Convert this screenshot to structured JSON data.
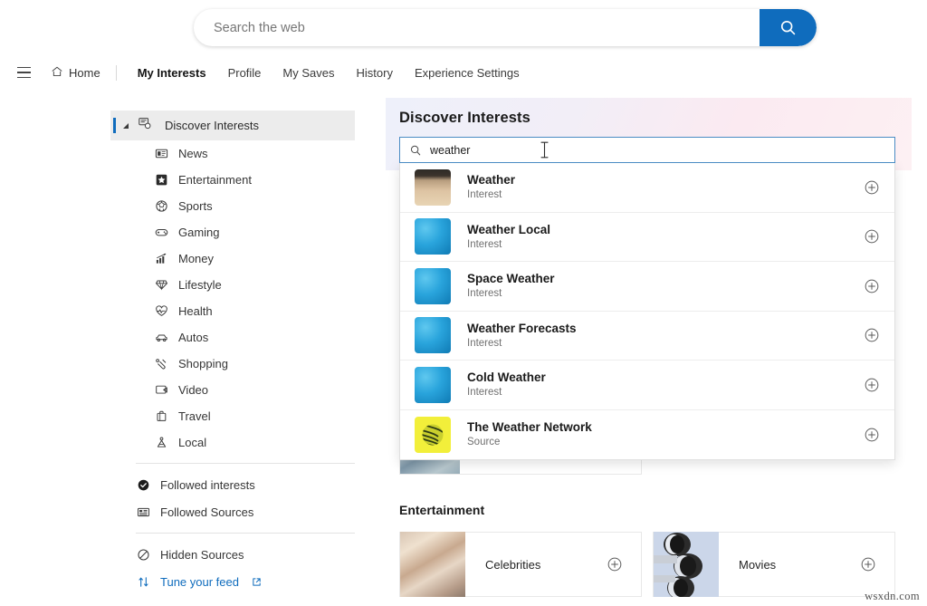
{
  "topbar": {
    "search_placeholder": "Search the web",
    "search_value": "",
    "search_button_icon": "search-icon"
  },
  "nav": {
    "menu_icon": "hamburger-menu-icon",
    "home_label": "Home",
    "home_icon": "home-icon",
    "links": [
      {
        "label": "My Interests",
        "active": true
      },
      {
        "label": "Profile",
        "active": false
      },
      {
        "label": "My Saves",
        "active": false
      },
      {
        "label": "History",
        "active": false
      },
      {
        "label": "Experience Settings",
        "active": false
      }
    ]
  },
  "sidebar": {
    "header": {
      "label": "Discover Interests",
      "icon": "discover-interests-icon",
      "expanded": true
    },
    "categories": [
      {
        "label": "News",
        "icon": "newspaper-icon"
      },
      {
        "label": "Entertainment",
        "icon": "star-badge-icon"
      },
      {
        "label": "Sports",
        "icon": "sports-ball-icon"
      },
      {
        "label": "Gaming",
        "icon": "gamepad-icon"
      },
      {
        "label": "Money",
        "icon": "bar-chart-icon"
      },
      {
        "label": "Lifestyle",
        "icon": "diamond-icon"
      },
      {
        "label": "Health",
        "icon": "heart-pulse-icon"
      },
      {
        "label": "Autos",
        "icon": "car-icon"
      },
      {
        "label": "Shopping",
        "icon": "shopping-tag-icon"
      },
      {
        "label": "Video",
        "icon": "video-screen-icon"
      },
      {
        "label": "Travel",
        "icon": "suitcase-icon"
      },
      {
        "label": "Local",
        "icon": "location-pin-person-icon"
      }
    ],
    "followed": [
      {
        "label": "Followed interests",
        "icon": "check-circle-filled-icon"
      },
      {
        "label": "Followed Sources",
        "icon": "sources-grid-icon"
      }
    ],
    "extras": [
      {
        "label": "Hidden Sources",
        "icon": "block-circle-icon",
        "link": false
      },
      {
        "label": "Tune your feed",
        "icon": "sort-arrows-icon",
        "link": true,
        "external_icon": "external-link-icon"
      }
    ]
  },
  "panel": {
    "title": "Discover Interests",
    "search": {
      "icon": "search-icon",
      "value": "weather",
      "placeholder": "",
      "cursor_icon": "text-ibeam-cursor"
    },
    "results": [
      {
        "title": "Weather",
        "subtitle": "Interest",
        "thumb": "tornado-photo",
        "add_icon": "plus-circle-icon"
      },
      {
        "title": "Weather Local",
        "subtitle": "Interest",
        "thumb": "blue-gradient-tile",
        "add_icon": "plus-circle-icon"
      },
      {
        "title": "Space Weather",
        "subtitle": "Interest",
        "thumb": "blue-gradient-tile",
        "add_icon": "plus-circle-icon"
      },
      {
        "title": "Weather Forecasts",
        "subtitle": "Interest",
        "thumb": "blue-gradient-tile",
        "add_icon": "plus-circle-icon"
      },
      {
        "title": "Cold Weather",
        "subtitle": "Interest",
        "thumb": "blue-gradient-tile",
        "add_icon": "plus-circle-icon"
      },
      {
        "title": "The Weather Network",
        "subtitle": "Source",
        "thumb": "yellow-globe-logo",
        "add_icon": "plus-circle-icon"
      }
    ]
  },
  "content": {
    "section_title": "Entertainment",
    "cards": [
      {
        "label": "Celebrities",
        "thumb": "celebrities-crowd-photo",
        "add_icon": "plus-circle-icon"
      },
      {
        "label": "Movies",
        "thumb": "movie-camera-lens-photo",
        "add_icon": "plus-circle-icon"
      }
    ]
  },
  "watermark": "wsxdn.com",
  "colors": {
    "accent_blue": "#0f6cbd",
    "search_button": "#0f6cbd",
    "link_blue": "#0f6cbd",
    "sidebar_selected_bg": "#ececec",
    "input_border_focus": "#4a8cc4"
  }
}
